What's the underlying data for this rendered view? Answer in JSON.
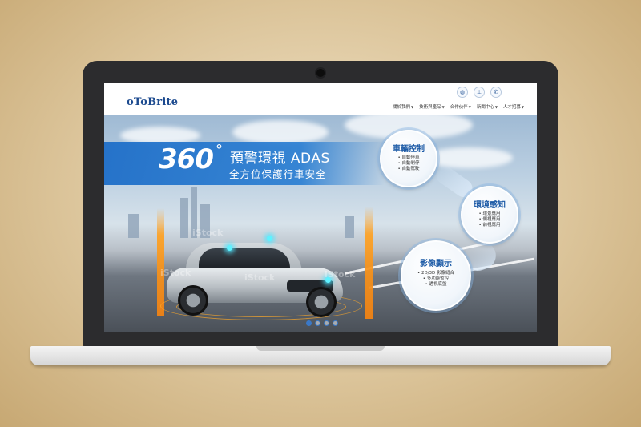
{
  "brand": {
    "logo": "oToBrite",
    "color": "#1c4a8f"
  },
  "top_icons": [
    {
      "name": "globe-icon",
      "glyph": "◍"
    },
    {
      "name": "sitemap-icon",
      "glyph": "⊥"
    },
    {
      "name": "phone-icon",
      "glyph": "✆"
    }
  ],
  "nav": [
    {
      "label": "關於我們",
      "caret": "▼"
    },
    {
      "label": "技術與產品",
      "caret": "▼"
    },
    {
      "label": "合作伙伴",
      "caret": "▼"
    },
    {
      "label": "新聞中心",
      "caret": "▼"
    },
    {
      "label": "人才招募",
      "caret": "▼"
    }
  ],
  "hero": {
    "number": "360",
    "degree": "°",
    "title": "預警環視 ADAS",
    "subtitle": "全方位保護行車安全",
    "watermark": "iStock",
    "features": [
      {
        "title": "車輛控制",
        "items": [
          "• 自動停車",
          "• 自動剎停",
          "• 自動駕駛"
        ]
      },
      {
        "title": "環境感知",
        "items": [
          "• 環景應用",
          "• 側視應用",
          "• 前視應用"
        ]
      },
      {
        "title": "影像顯示",
        "items": [
          "• 2D/3D 影像縫合",
          "• 多功能監控",
          "• 透視底盤"
        ]
      }
    ],
    "slides": {
      "count": 4,
      "active": 1
    }
  }
}
